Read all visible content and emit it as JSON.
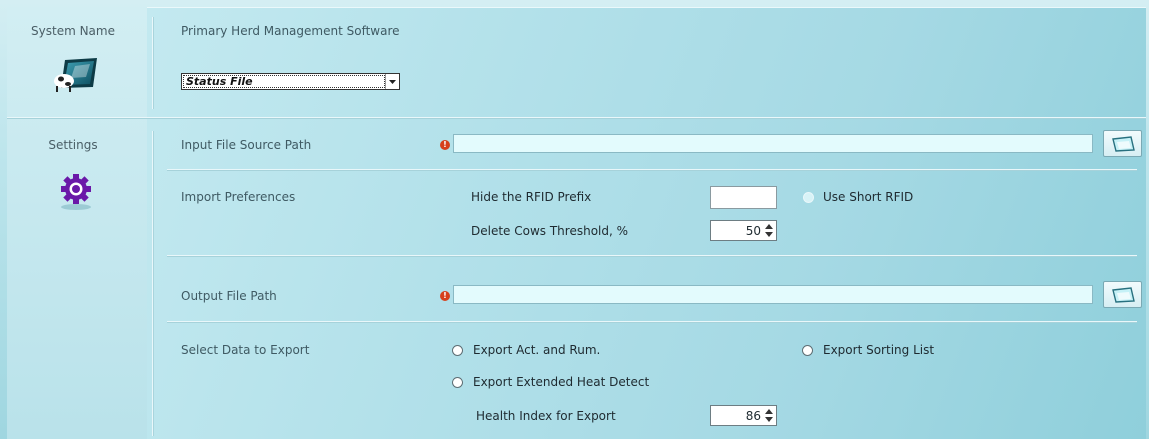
{
  "sidebar": {
    "items": [
      {
        "label": "System Name",
        "icon": "cow-monitor-icon"
      },
      {
        "label": "Settings",
        "icon": "gear-icon"
      }
    ]
  },
  "system": {
    "title": "Primary Herd Management Software",
    "selected_file": "Status File"
  },
  "input_path": {
    "label": "Input File Source Path",
    "value": ""
  },
  "import_prefs": {
    "label": "Import Preferences",
    "hide_rfid_label": "Hide the RFID Prefix",
    "hide_rfid_value": "",
    "use_short_rfid_label": "Use Short RFID",
    "delete_threshold_label": "Delete Cows Threshold, %",
    "delete_threshold_value": "50"
  },
  "output_path": {
    "label": "Output File Path",
    "value": ""
  },
  "export": {
    "label": "Select Data to Export",
    "act_rum_label": "Export Act. and Rum.",
    "sorting_list_label": "Export Sorting List",
    "extended_heat_label": "Export Extended Heat Detect",
    "health_index_label": "Health Index for Export",
    "health_index_value": "86"
  },
  "colors": {
    "accent_gear": "#7a1fb8",
    "warning": "#d6401c",
    "field_bg": "#e3fbfd"
  }
}
